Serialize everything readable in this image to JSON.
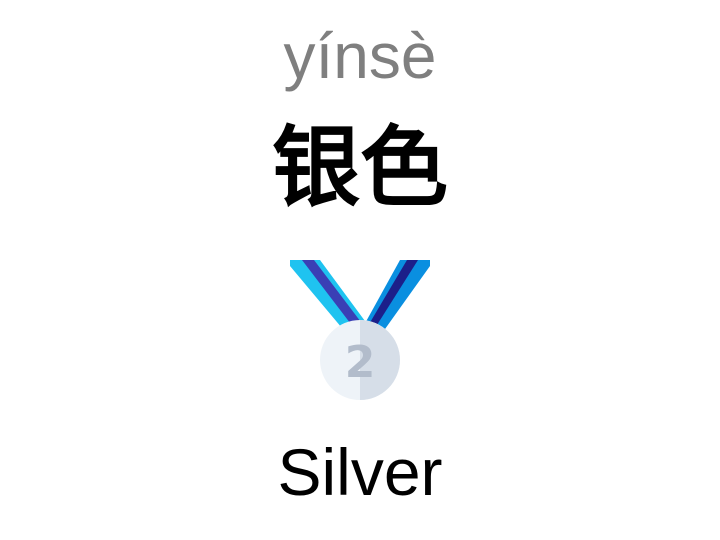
{
  "card": {
    "pinyin": "yínsè",
    "hanzi": "银色",
    "english": "Silver"
  },
  "medal": {
    "icon": "silver-medal-icon",
    "number": "2",
    "colors": {
      "ribbon_light": "#1fc3f0",
      "ribbon_dark": "#0a8fe0",
      "ribbon_stripe": "#3a3fb5",
      "medal_light": "#eef3f8",
      "medal_shade": "#d6dee8",
      "medal_number": "#b2bccb"
    }
  }
}
